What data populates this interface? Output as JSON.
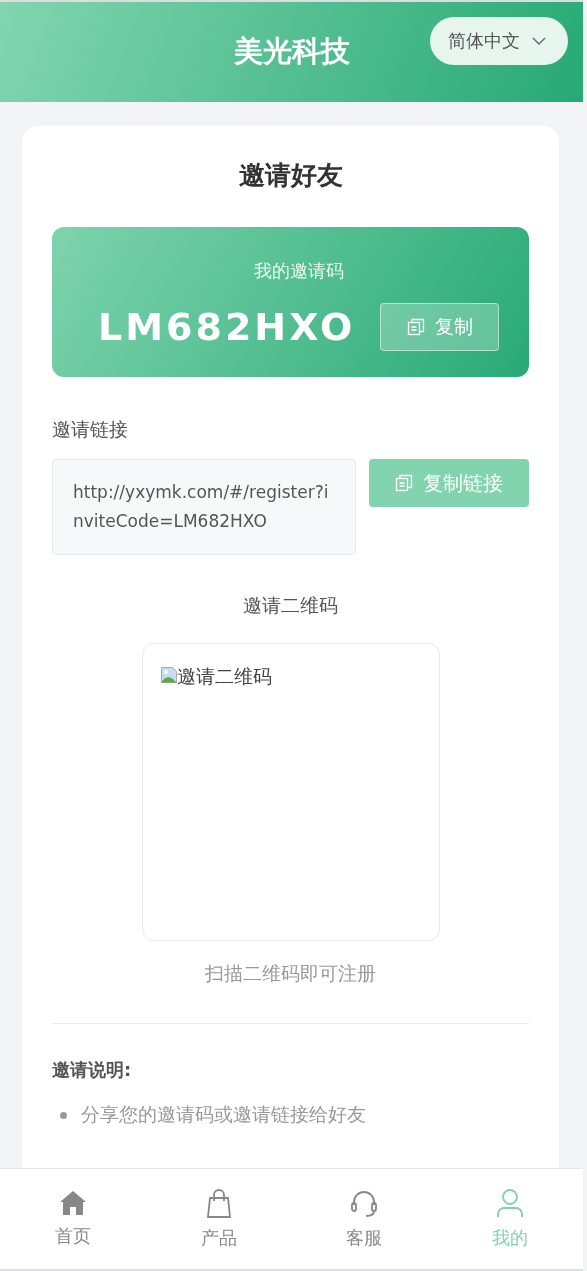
{
  "header": {
    "title": "美光科技",
    "language": "简体中文"
  },
  "page": {
    "title": "邀请好友"
  },
  "invite_code": {
    "label": "我的邀请码",
    "code": "LM682HXO",
    "copy_button": "复制"
  },
  "invite_link": {
    "label": "邀请链接",
    "url": "http://yxymk.com/#/register?inviteCode=LM682HXO",
    "copy_button": "复制链接"
  },
  "qr": {
    "label": "邀请二维码",
    "alt": "邀请二维码",
    "caption": "扫描二维码即可注册"
  },
  "instructions": {
    "title": "邀请说明:",
    "items": [
      "分享您的邀请码或邀请链接给好友"
    ]
  },
  "nav": [
    {
      "label": "首页",
      "kind": "home",
      "selected": false
    },
    {
      "label": "产品",
      "kind": "bag",
      "selected": false
    },
    {
      "label": "客服",
      "kind": "headset",
      "selected": false
    },
    {
      "label": "我的",
      "kind": "person",
      "selected": true
    }
  ]
}
